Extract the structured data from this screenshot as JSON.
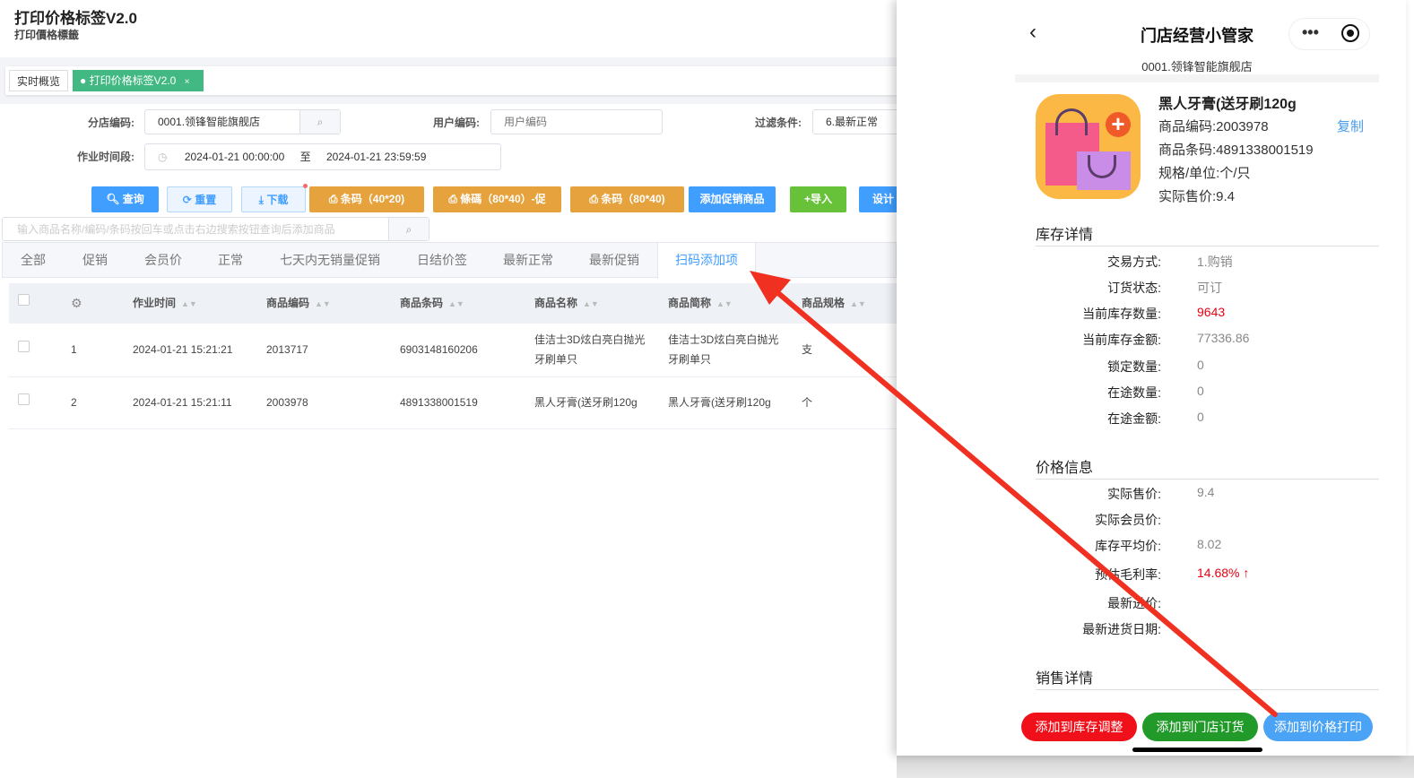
{
  "header": {
    "title": "打印价格标签V2.0",
    "subtitle": "打印價格標籤"
  },
  "page_tabs": [
    {
      "label": "实时概览"
    },
    {
      "label": "打印价格标签V2.0",
      "close": "×"
    }
  ],
  "form": {
    "branch_label": "分店编码:",
    "branch_value": "0001.领锋智能旗舰店",
    "user_label": "用户编码:",
    "user_placeholder": "用户编码",
    "filter_label": "过滤条件:",
    "filter_value": "6.最新正常",
    "period_label": "作业时间段:",
    "start": "2024-01-21 00:00:00",
    "to": "至",
    "end": "2024-01-21 23:59:59"
  },
  "buttons": {
    "query": "查询",
    "reset": "重置",
    "download": "下载",
    "barcode1": "条码（40*20)",
    "barcode2": "條碼（80*40）-促",
    "barcode3": "条码（80*40)",
    "add_promo": "添加促销商品",
    "import": "+导入",
    "design": "设计"
  },
  "search_placeholder": "输入商品名称/编码/条码按回车或点击右边搜索按钮查询后添加商品",
  "filter_tabs": [
    "全部",
    "促销",
    "会员价",
    "正常",
    "七天内无销量促销",
    "日结价签",
    "最新正常",
    "最新促销",
    "扫码添加项"
  ],
  "active_filter_tab": "扫码添加项",
  "table": {
    "columns": [
      "作业时间",
      "商品编码",
      "商品条码",
      "商品名称",
      "商品简称",
      "商品规格"
    ],
    "rows": [
      {
        "no": "1",
        "time": "2024-01-21 15:21:21",
        "code": "2013717",
        "barcode": "6903148160206",
        "name": "佳洁士3D炫白亮白抛光牙刷单只",
        "short": "佳洁士3D炫白亮白抛光牙刷单只",
        "spec": "支"
      },
      {
        "no": "2",
        "time": "2024-01-21 15:21:11",
        "code": "2003978",
        "barcode": "4891338001519",
        "name": "黑人牙膏(送牙刷120g",
        "short": "黑人牙膏(送牙刷120g",
        "spec": "个"
      }
    ]
  },
  "mobile": {
    "title": "门店经营小管家",
    "store": "0001.领锋智能旗舰店",
    "product": {
      "name": "黑人牙膏(送牙刷120g",
      "code": "商品编码:2003978",
      "copy": "复制",
      "barcode": "商品条码:4891338001519",
      "unit": "规格/单位:个/只",
      "price": "实际售价:9.4"
    },
    "inventory_title": "库存详情",
    "inventory": [
      {
        "label": "交易方式:",
        "value": "1.购销"
      },
      {
        "label": "订货状态:",
        "value": "可订"
      },
      {
        "label": "当前库存数量:",
        "value": "9643",
        "highlight": true
      },
      {
        "label": "当前库存金额:",
        "value": "77336.86"
      },
      {
        "label": "锁定数量:",
        "value": "0"
      },
      {
        "label": "在途数量:",
        "value": "0"
      },
      {
        "label": "在途金额:",
        "value": "0"
      }
    ],
    "price_title": "价格信息",
    "price": [
      {
        "label": "实际售价:",
        "value": "9.4"
      },
      {
        "label": "实际会员价:",
        "value": ""
      },
      {
        "label": "库存平均价:",
        "value": "8.02"
      },
      {
        "label": "预估毛利率:",
        "value": "14.68% ↑",
        "highlight": true
      },
      {
        "label": "最新进价:",
        "value": ""
      },
      {
        "label": "最新进货日期:",
        "value": ""
      }
    ],
    "sales_title": "销售详情",
    "actions": {
      "stock_adjust": "添加到库存调整",
      "order": "添加到门店订货",
      "price_print": "添加到价格打印"
    }
  },
  "colors": {
    "primary": "#409eff",
    "orange": "#e6a23c",
    "green": "#67c23a",
    "tag_green": "#42b983",
    "red": "#e60012",
    "annotation_arrow": "#f03020"
  }
}
